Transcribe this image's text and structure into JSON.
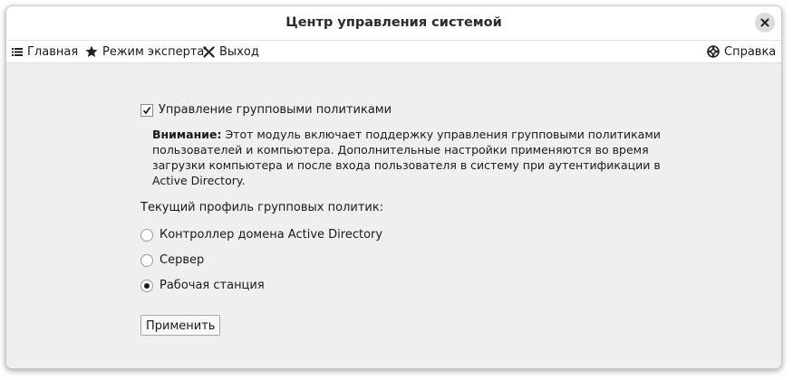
{
  "window": {
    "title": "Центр управления системой"
  },
  "toolbar": {
    "home_label": "Главная",
    "expert_label": "Режим эксперта",
    "exit_label": "Выход",
    "help_label": "Справка"
  },
  "gpo": {
    "checkbox_label": "Управление групповыми политиками",
    "checked": true,
    "warning_title": "Внимание:",
    "warning_text": "Этот модуль включает поддержку управления групповыми политиками пользователей и компьютера. Дополнительные настройки применяются во время загрузки компьютера и после входа пользователя в систему при аутентификации в Active Directory.",
    "profile_label": "Текущий профиль групповых политик:",
    "profiles": [
      {
        "label": "Контроллер домена Active Directory",
        "selected": false
      },
      {
        "label": "Сервер",
        "selected": false
      },
      {
        "label": "Рабочая станция",
        "selected": true
      }
    ],
    "apply_label": "Применить"
  }
}
